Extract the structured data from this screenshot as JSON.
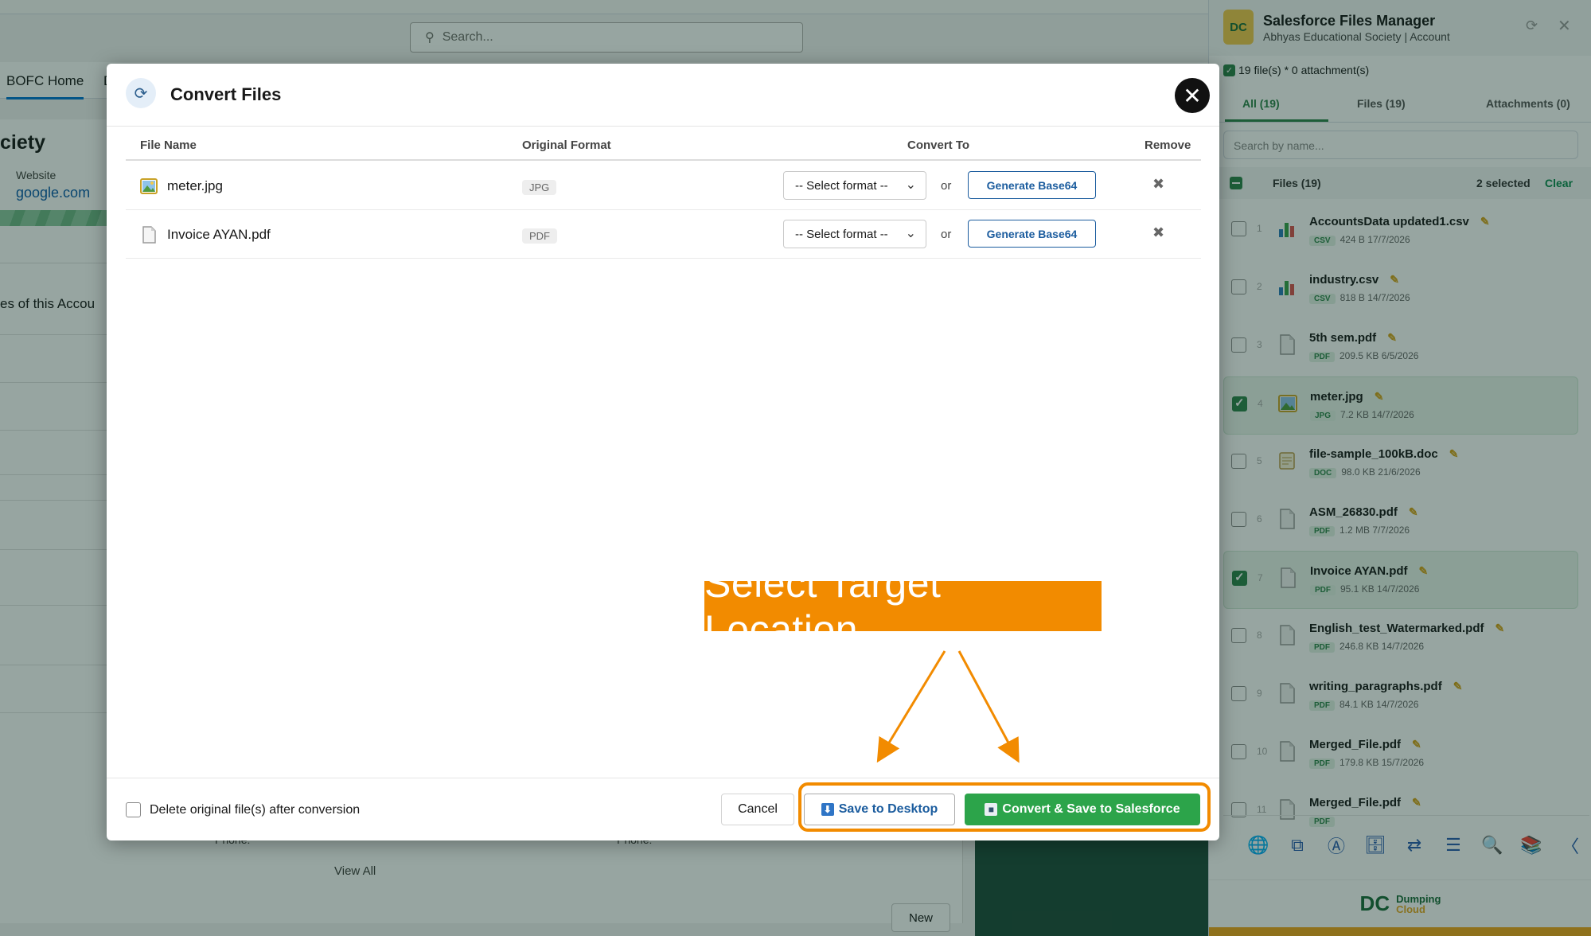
{
  "background": {
    "search_placeholder": "Search...",
    "nav_home": "BOFC Home",
    "nav_more": "D",
    "account_name_partial": "ciety",
    "website_label": "Website",
    "website_value": "google.com",
    "files_section_partial": "es of this Accou",
    "phone_a": "Phone:",
    "phone_b": "Phone:",
    "view_all": "View All",
    "new_button": "New"
  },
  "panel": {
    "title": "Salesforce Files Manager",
    "subtitle": "Abhyas Educational Society | Account",
    "logo_text": "DC",
    "count_text": "19 file(s) * 0 attachment(s)",
    "tabs": [
      {
        "label": "All (19)"
      },
      {
        "label": "Files (19)"
      },
      {
        "label": "Attachments (0)"
      }
    ],
    "search_placeholder": "Search by name...",
    "files_label": "Files (19)",
    "selected_text": "2 selected",
    "clear_label": "Clear",
    "files": [
      {
        "num": "1",
        "name": "AccountsData updated1.csv",
        "type": "CSV",
        "size": "424 B",
        "date": "17/7/2026",
        "selected": false,
        "icon": "chart-icon"
      },
      {
        "num": "2",
        "name": "industry.csv",
        "type": "CSV",
        "size": "818 B",
        "date": "14/7/2026",
        "selected": false,
        "icon": "chart-icon"
      },
      {
        "num": "3",
        "name": "5th sem.pdf",
        "type": "PDF",
        "size": "209.5 KB",
        "date": "6/5/2026",
        "selected": false,
        "icon": "document-icon"
      },
      {
        "num": "4",
        "name": "meter.jpg",
        "type": "JPG",
        "size": "7.2 KB",
        "date": "14/7/2026",
        "selected": true,
        "icon": "image-icon"
      },
      {
        "num": "5",
        "name": "file-sample_100kB.doc",
        "type": "DOC",
        "size": "98.0 KB",
        "date": "21/6/2026",
        "selected": false,
        "icon": "memo-icon"
      },
      {
        "num": "6",
        "name": "ASM_26830.pdf",
        "type": "PDF",
        "size": "1.2 MB",
        "date": "7/7/2026",
        "selected": false,
        "icon": "document-icon"
      },
      {
        "num": "7",
        "name": "Invoice AYAN.pdf",
        "type": "PDF",
        "size": "95.1 KB",
        "date": "14/7/2026",
        "selected": true,
        "icon": "document-icon"
      },
      {
        "num": "8",
        "name": "English_test_Watermarked.pdf",
        "type": "PDF",
        "size": "246.8 KB",
        "date": "14/7/2026",
        "selected": false,
        "icon": "document-icon"
      },
      {
        "num": "9",
        "name": "writing_paragraphs.pdf",
        "type": "PDF",
        "size": "84.1 KB",
        "date": "14/7/2026",
        "selected": false,
        "icon": "document-icon"
      },
      {
        "num": "10",
        "name": "Merged_File.pdf",
        "type": "PDF",
        "size": "179.8 KB",
        "date": "15/7/2026",
        "selected": false,
        "icon": "document-icon"
      },
      {
        "num": "11",
        "name": "Merged_File.pdf",
        "type": "PDF",
        "size": "",
        "date": "",
        "selected": false,
        "icon": "document-icon"
      }
    ],
    "toolbar_icons": [
      "globe-icon",
      "ocr-icon",
      "text-recognition-icon",
      "archive-icon",
      "compress-icon",
      "document-text-icon",
      "search-document-icon",
      "books-icon",
      "more-icon"
    ],
    "footer_logo": "DC",
    "footer_brand_1": "Dumping",
    "footer_brand_2": "Cloud"
  },
  "modal": {
    "title": "Convert Files",
    "columns": {
      "file_name": "File Name",
      "original_format": "Original Format",
      "convert_to": "Convert To",
      "remove": "Remove"
    },
    "rows": [
      {
        "name": "meter.jpg",
        "format": "JPG",
        "select_value": "-- Select format --",
        "or": "or",
        "base64_label": "Generate Base64",
        "icon": "image-icon"
      },
      {
        "name": "Invoice AYAN.pdf",
        "format": "PDF",
        "select_value": "-- Select format --",
        "or": "or",
        "base64_label": "Generate Base64",
        "icon": "document-icon"
      }
    ],
    "delete_label": "Delete original file(s) after conversion",
    "cancel_label": "Cancel",
    "save_desktop_label": "Save to Desktop",
    "save_salesforce_label": "Convert & Save to Salesforce"
  },
  "annotation": {
    "callout_text": "Select Target Location",
    "color": "#f28b00"
  }
}
